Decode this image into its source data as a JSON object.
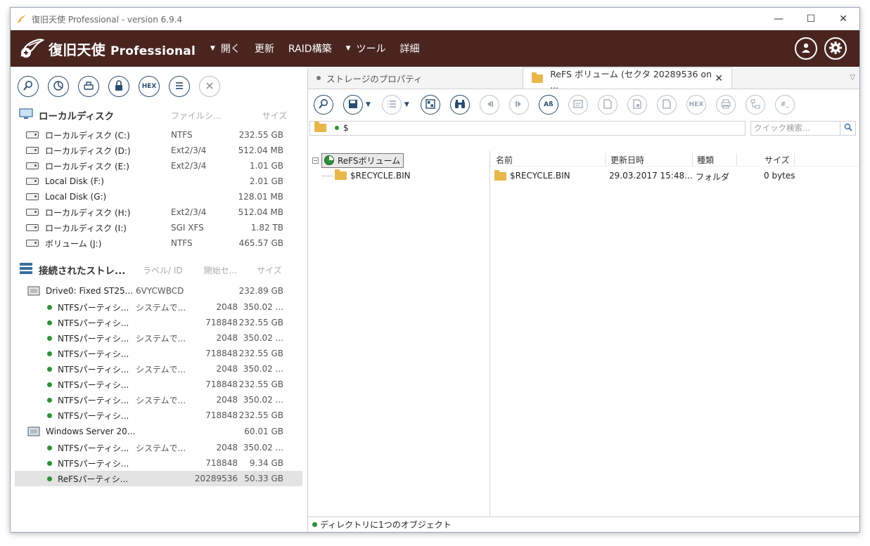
{
  "window": {
    "title": "復旧天使 Professional - version 6.9.4",
    "minimize": "—",
    "maximize": "☐",
    "close": "✕"
  },
  "menubar": {
    "logo_main": "復旧天使",
    "logo_sub": "Professional",
    "items": [
      {
        "label": "開く",
        "caret": true
      },
      {
        "label": "更新",
        "caret": false
      },
      {
        "label": "RAID構築",
        "caret": false
      },
      {
        "label": "ツール",
        "caret": true
      },
      {
        "label": "詳細",
        "caret": false
      }
    ],
    "caret_glyph": "▼"
  },
  "left_toolbar": {
    "hex_label": "HEX"
  },
  "local_disks": {
    "title": "ローカルディスク",
    "col_fs": "ファイルシ...",
    "col_size": "サイズ",
    "items": [
      {
        "name": "ローカルディスク (C:)",
        "fs": "NTFS",
        "size": "232.55 GB"
      },
      {
        "name": "ローカルディスク (D:)",
        "fs": "Ext2/3/4",
        "size": "512.04 MB"
      },
      {
        "name": "ローカルディスク (E:)",
        "fs": "Ext2/3/4",
        "size": "1.01 GB"
      },
      {
        "name": "Local Disk (F:)",
        "fs": "",
        "size": "2.01 GB"
      },
      {
        "name": "Local Disk (G:)",
        "fs": "",
        "size": "128.01 MB"
      },
      {
        "name": "ローカルディスク (H:)",
        "fs": "Ext2/3/4",
        "size": "512.04 MB"
      },
      {
        "name": "ローカルディスク (I:)",
        "fs": "SGI XFS",
        "size": "1.82 TB"
      },
      {
        "name": "ボリューム (J:)",
        "fs": "NTFS",
        "size": "465.57 GB"
      }
    ]
  },
  "storage": {
    "title": "接続されたストレ...",
    "col_label": "ラベル/ ID",
    "col_start": "開始セ...",
    "col_size": "サイズ",
    "drive0": {
      "name": "Drive0: Fixed ST25...",
      "id": "6VYCWBCD",
      "size": "232.89 GB"
    },
    "drive0_parts": [
      {
        "name": "NTFSパーティシ...",
        "label": "システムで...",
        "start": "2048",
        "size": "350.02 ..."
      },
      {
        "name": "NTFSパーティシ...",
        "label": "",
        "start": "718848",
        "size": "232.55 GB"
      },
      {
        "name": "NTFSパーティシ...",
        "label": "システムで...",
        "start": "2048",
        "size": "350.02 ..."
      },
      {
        "name": "NTFSパーティシ...",
        "label": "",
        "start": "718848",
        "size": "232.55 GB"
      },
      {
        "name": "NTFSパーティシ...",
        "label": "システムで...",
        "start": "2048",
        "size": "350.02 ..."
      },
      {
        "name": "NTFSパーティシ...",
        "label": "",
        "start": "718848",
        "size": "232.55 GB"
      },
      {
        "name": "NTFSパーティシ...",
        "label": "システムで...",
        "start": "2048",
        "size": "350.02 ..."
      },
      {
        "name": "NTFSパーティシ...",
        "label": "",
        "start": "718848",
        "size": "232.55 GB"
      }
    ],
    "drive1": {
      "name": "Windows Server 20...",
      "size": "60.01 GB"
    },
    "drive1_parts": [
      {
        "name": "NTFSパーティシ...",
        "label": "システムで...",
        "start": "2048",
        "size": "350.02 ..."
      },
      {
        "name": "NTFSパーティシ...",
        "label": "",
        "start": "718848",
        "size": "9.34 GB"
      },
      {
        "name": "ReFSパーティシ...",
        "label": "",
        "start": "20289536",
        "size": "50.33 GB",
        "selected": true
      }
    ]
  },
  "tabs": {
    "inactive_label": "ストレージのプロパティ",
    "active_label": "ReFS ボリューム (セクタ 20289536 on ...",
    "close": "✕",
    "overflow": "▽"
  },
  "right_toolbar": {
    "hex_label": "HEX",
    "ab_label": "Aß",
    "hash_label": "#_",
    "dd_caret": "▼"
  },
  "pathbar": {
    "path": "$",
    "search_placeholder": "クイック検索..."
  },
  "tree": {
    "root": "ReFSボリューム",
    "expander": "−",
    "child": "$RECYCLE.BIN"
  },
  "list": {
    "headers": {
      "name": "名前",
      "modified": "更新日時",
      "type": "種類",
      "size": "サイズ"
    },
    "rows": [
      {
        "name": "$RECYCLE.BIN",
        "modified": "29.03.2017 15:48...",
        "type": "フォルダ",
        "size": "0 bytes"
      }
    ]
  },
  "status": {
    "text": "ディレクトリに1つのオブジェクト"
  }
}
